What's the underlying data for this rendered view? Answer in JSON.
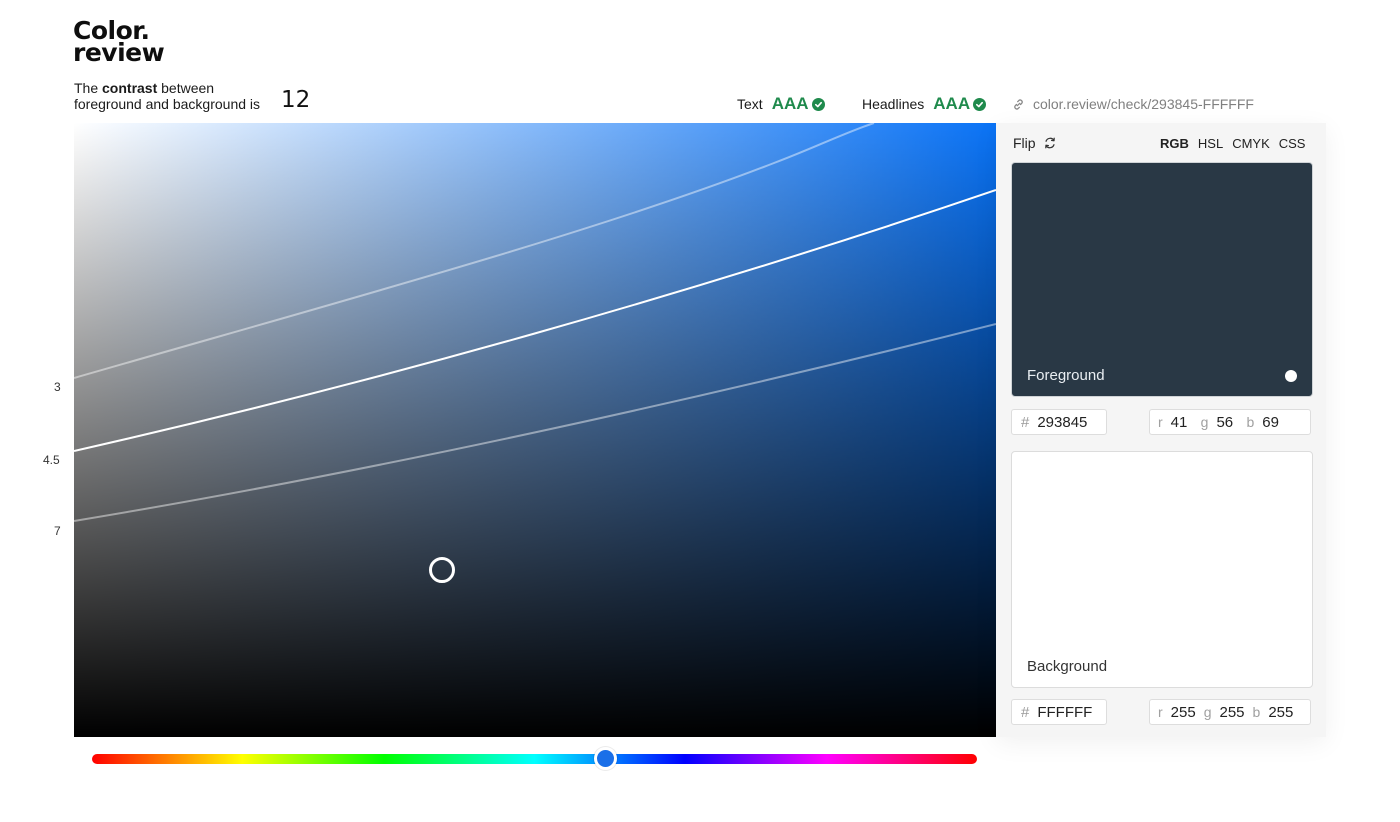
{
  "logo": {
    "line1": "Color.",
    "line2": "review"
  },
  "header": {
    "contrast_prefix": "The ",
    "contrast_bold": "contrast",
    "contrast_suffix": " between",
    "contrast_line2": "foreground and background is",
    "contrast_value": "12",
    "ratings": [
      {
        "label": "Text",
        "grade": "AAA"
      },
      {
        "label": "Headlines",
        "grade": "AAA"
      }
    ],
    "share_link": "color.review/check/293845-FFFFFF"
  },
  "axis": {
    "labels": [
      "3",
      "4.5",
      "7"
    ]
  },
  "panel": {
    "flip_label": "Flip",
    "modes": [
      "RGB",
      "HSL",
      "CMYK",
      "CSS"
    ],
    "active_mode": "RGB",
    "foreground": {
      "label": "Foreground",
      "hex_prefix": "#",
      "hex": "293845",
      "color": "#293845",
      "r": "41",
      "g": "56",
      "b": "69"
    },
    "background": {
      "label": "Background",
      "hex_prefix": "#",
      "hex": "FFFFFF",
      "color": "#FFFFFF",
      "r": "255",
      "g": "255",
      "b": "255"
    },
    "channel_labels": {
      "r": "r",
      "g": "g",
      "b": "b"
    }
  },
  "hue_slider": {
    "value": 0.58
  },
  "colors": {
    "accent": "#0A73F6",
    "pass": "#1F8A4C"
  }
}
